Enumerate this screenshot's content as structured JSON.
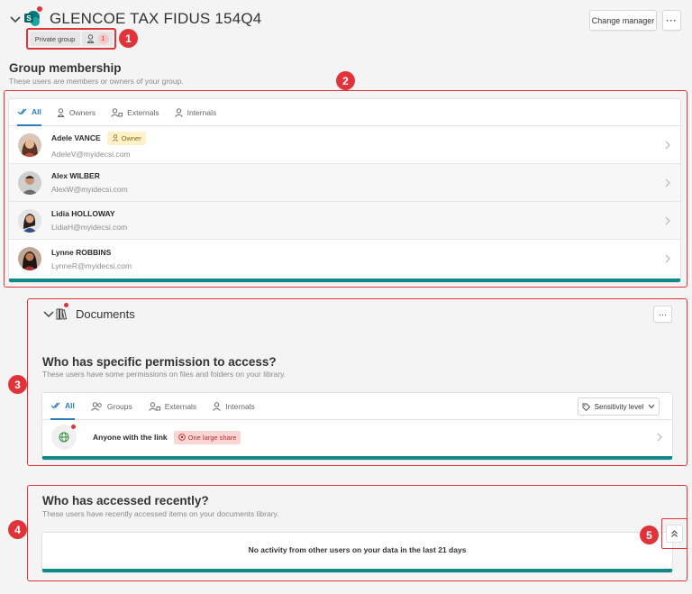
{
  "header": {
    "title": "GLENCOE TAX FIDUS 154Q4",
    "change_manager_label": "Change manager",
    "more_label": "···",
    "private_group_label": "Private group",
    "owner_count": "1"
  },
  "markers": [
    "1",
    "2",
    "3",
    "4",
    "5"
  ],
  "membership": {
    "title": "Group membership",
    "subtitle": "These users are members or owners of your group.",
    "tabs": [
      {
        "label": "All",
        "icon": "check-all-icon",
        "active": true
      },
      {
        "label": "Owners",
        "icon": "owner-icon",
        "active": false
      },
      {
        "label": "Externals",
        "icon": "external-users-icon",
        "active": false
      },
      {
        "label": "Internals",
        "icon": "user-icon",
        "active": false
      }
    ],
    "owner_badge": "Owner",
    "members": [
      {
        "name": "Adele VANCE",
        "email": "AdeleV@myidecsi.com",
        "is_owner": true
      },
      {
        "name": "Alex WILBER",
        "email": "AlexW@myidecsi.com",
        "is_owner": false
      },
      {
        "name": "Lidia HOLLOWAY",
        "email": "LidiaH@myidecsi.com",
        "is_owner": false
      },
      {
        "name": "Lynne ROBBINS",
        "email": "LynneR@myidecsi.com",
        "is_owner": false
      }
    ]
  },
  "documents": {
    "title": "Documents",
    "more_label": "···",
    "permission_title": "Who has specific permission to access?",
    "permission_subtitle": "These users have some permissions on files and folders on your library.",
    "tabs": [
      {
        "label": "All",
        "icon": "check-all-icon",
        "active": true
      },
      {
        "label": "Groups",
        "icon": "group-icon",
        "active": false
      },
      {
        "label": "Externals",
        "icon": "external-users-icon",
        "active": false
      },
      {
        "label": "Internals",
        "icon": "user-icon",
        "active": false
      }
    ],
    "sensitivity_label": "Sensitivity level",
    "link_row_label": "Anyone with the link",
    "share_badge": "One large share"
  },
  "recent": {
    "title": "Who has accessed recently?",
    "subtitle": "These users have recently accessed items on your documents library.",
    "empty_message": "No activity from other users on your data in the last 21 days"
  },
  "colors": {
    "marker_red": "#e0343a",
    "accent_blue": "#2a7dc0",
    "teal_bar": "#13888a",
    "owner_badge_bg": "#fff1c9",
    "share_badge_bg": "#fbd4d4"
  }
}
